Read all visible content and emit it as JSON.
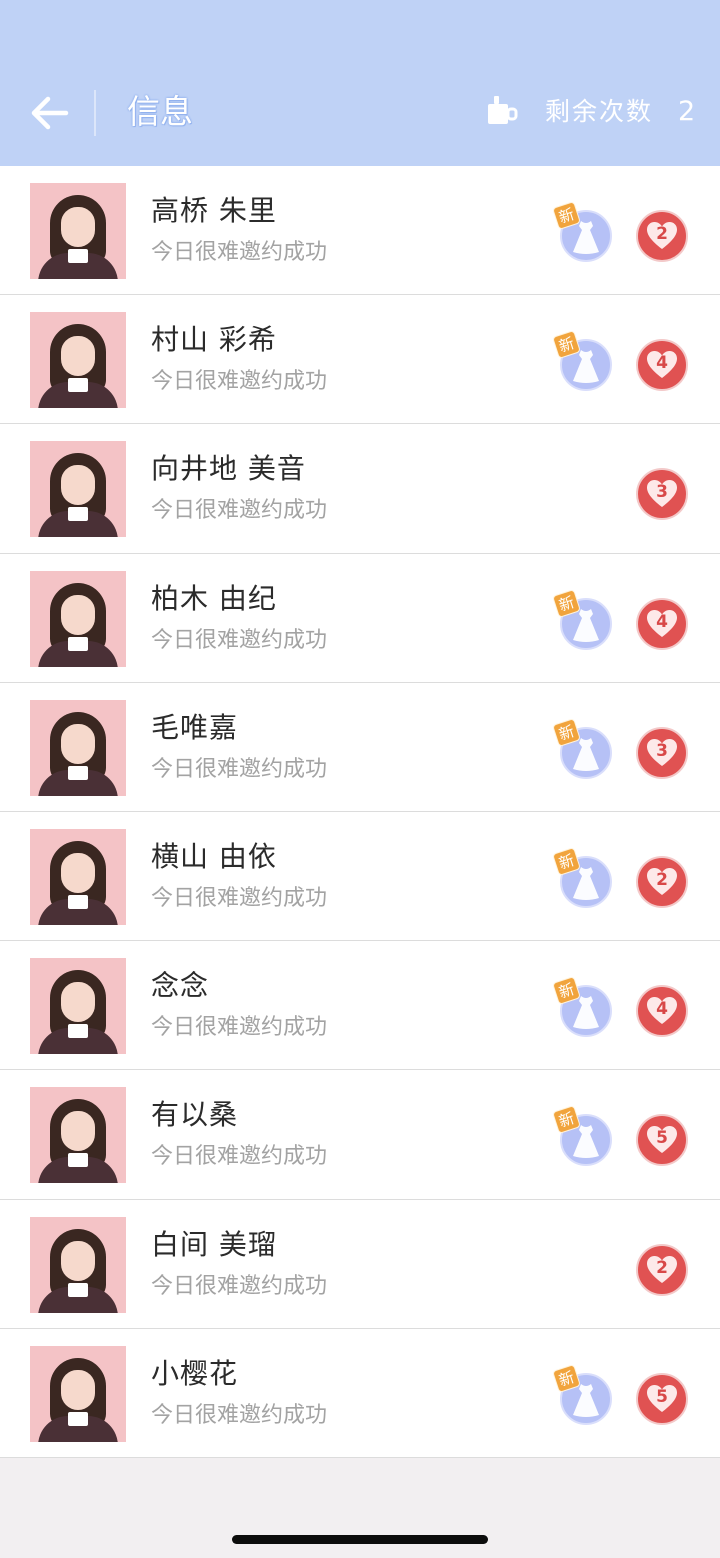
{
  "header": {
    "title": "信息",
    "remaining_label": "剩余次数",
    "remaining_count": "2",
    "back_icon": "back-arrow-icon",
    "cup_icon": "cup-icon"
  },
  "badges": {
    "new_label": "新"
  },
  "items": [
    {
      "name": "高桥 朱里",
      "status": "今日很难邀约成功",
      "new_outfit": true,
      "hearts": "2"
    },
    {
      "name": "村山 彩希",
      "status": "今日很难邀约成功",
      "new_outfit": true,
      "hearts": "4"
    },
    {
      "name": "向井地 美音",
      "status": "今日很难邀约成功",
      "new_outfit": false,
      "hearts": "3"
    },
    {
      "name": "柏木 由纪",
      "status": "今日很难邀约成功",
      "new_outfit": true,
      "hearts": "4"
    },
    {
      "name": "毛唯嘉",
      "status": "今日很难邀约成功",
      "new_outfit": true,
      "hearts": "3"
    },
    {
      "name": "横山 由依",
      "status": "今日很难邀约成功",
      "new_outfit": true,
      "hearts": "2"
    },
    {
      "name": "念念",
      "status": "今日很难邀约成功",
      "new_outfit": true,
      "hearts": "4"
    },
    {
      "name": "有以桑",
      "status": "今日很难邀约成功",
      "new_outfit": true,
      "hearts": "5"
    },
    {
      "name": "白间 美瑠",
      "status": "今日很难邀约成功",
      "new_outfit": false,
      "hearts": "2"
    },
    {
      "name": "小樱花",
      "status": "今日很难邀约成功",
      "new_outfit": true,
      "hearts": "5"
    }
  ],
  "colors": {
    "header_bg": "#bfd2f6",
    "heart_badge": "#e05252",
    "outfit_circle": "#b6c1f6",
    "new_badge": "#f1a43d"
  }
}
